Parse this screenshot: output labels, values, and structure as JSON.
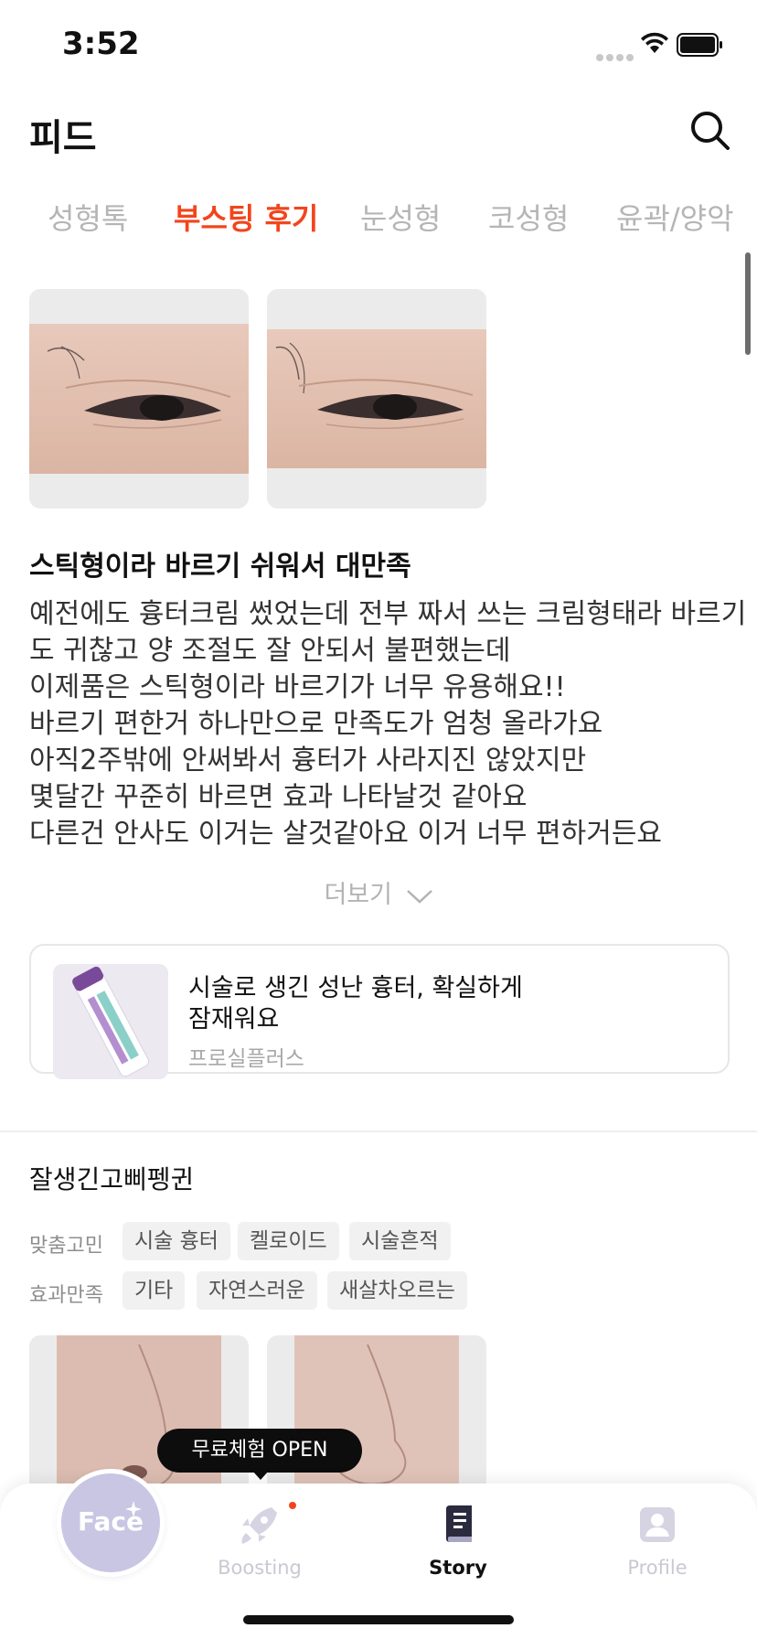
{
  "status_bar": {
    "time": "3:52"
  },
  "header": {
    "title": "피드",
    "search_icon": "search-icon"
  },
  "tabs": [
    {
      "label": "성형톡",
      "active": false
    },
    {
      "label": "부스팅 후기",
      "active": true
    },
    {
      "label": "눈성형",
      "active": false
    },
    {
      "label": "코성형",
      "active": false
    },
    {
      "label": "윤곽/양악",
      "active": false
    }
  ],
  "post": {
    "title": "스틱형이라 바르기 쉬워서 대만족",
    "body_lines": [
      "예전에도 흉터크림 썼었는데 전부 짜서 쓰는 크림형태라 바르기",
      "도 귀찮고 양 조절도 잘 안되서 불편했는데",
      "이제품은 스틱형이라 바르기가 너무 유용해요!!",
      "바르기 편한거 하나만으로 만족도가 엄청 올라가요",
      "아직2주밖에 안써봐서 흉터가 사라지진 않았지만",
      "몇달간 꾸준히 바르면 효과 나타날것 같아요",
      "다른건 안사도 이거는 살것같아요 이거 너무 편하거든요"
    ],
    "more_label": "더보기",
    "product": {
      "title_line1": "시술로 생긴 성난 흉터, 확실하게",
      "title_line2": "잠재워요",
      "brand": "프로실플러스"
    }
  },
  "post2": {
    "author": "잘생긴고삐펭귄",
    "concern_label": "맞춤고민",
    "concern_tags": [
      "시술 흉터",
      "켈로이드",
      "시술흔적"
    ],
    "effect_label": "효과만족",
    "effect_tags": [
      "기타",
      "자연스러운",
      "새살차오르는"
    ]
  },
  "tooltip": {
    "text": "무료체험 OPEN"
  },
  "bottom_nav": {
    "face_label": "Face",
    "items": [
      {
        "label": "Boosting",
        "icon": "rocket-icon",
        "active": false
      },
      {
        "label": "Story",
        "icon": "book-icon",
        "active": true
      },
      {
        "label": "Profile",
        "icon": "profile-icon",
        "active": false
      }
    ]
  },
  "colors": {
    "accent": "#f2451c",
    "inactive_tab": "#b5b5b5",
    "face_button": "#c8c6e3",
    "nav_inactive": "#c9c9d1"
  }
}
